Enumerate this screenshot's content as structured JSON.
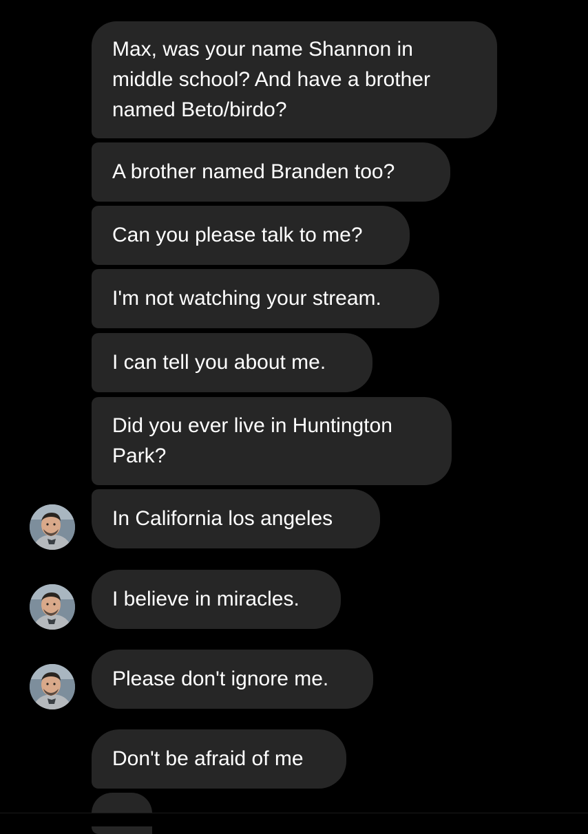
{
  "colors": {
    "background": "#000000",
    "bubble": "#262626",
    "text": "#ffffff"
  },
  "messages": [
    {
      "lines": [
        "Max, was your name Shannon in",
        "middle school? And have a brother",
        "named Beto/birdo?"
      ]
    },
    {
      "lines": [
        "A brother named Branden too?"
      ]
    },
    {
      "lines": [
        "Can you please talk to me?"
      ]
    },
    {
      "lines": [
        "I'm not watching your stream."
      ]
    },
    {
      "lines": [
        "I can tell you about me."
      ]
    },
    {
      "lines": [
        "Did you ever live in Huntington",
        "Park?"
      ]
    },
    {
      "lines": [
        "In California los angeles"
      ],
      "avatar": "profile-photo-icon"
    },
    {
      "lines": [
        "I believe in miracles."
      ],
      "avatar": "profile-photo-icon"
    },
    {
      "lines": [
        "Please don't ignore me."
      ],
      "avatar": "profile-photo-icon"
    },
    {
      "lines": [
        "Don't be afraid of me"
      ]
    }
  ]
}
